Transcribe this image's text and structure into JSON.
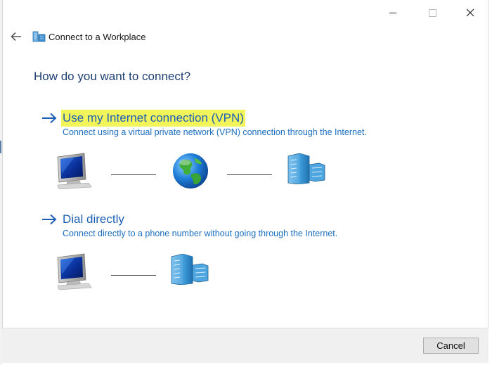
{
  "window": {
    "title": "Connect to a Workplace",
    "icons": [
      "back-arrow-icon",
      "network-workplace-icon",
      "minimize-icon",
      "maximize-icon",
      "close-icon"
    ]
  },
  "heading": "How do you want to connect?",
  "options": [
    {
      "label": "Use my Internet connection (VPN)",
      "description": "Connect using a virtual private network (VPN) connection through the Internet.",
      "highlight_color": "#f2f55a",
      "diagram_icons": [
        "computer-icon",
        "globe-icon",
        "server-building-icon"
      ]
    },
    {
      "label": "Dial directly",
      "description": "Connect directly to a phone number without going through the Internet.",
      "diagram_icons": [
        "computer-icon",
        "server-building-icon"
      ]
    }
  ],
  "footer": {
    "cancel_label": "Cancel"
  },
  "colors": {
    "heading": "#1e3f72",
    "link": "#1d5fb5",
    "description": "#1d6fbf"
  }
}
